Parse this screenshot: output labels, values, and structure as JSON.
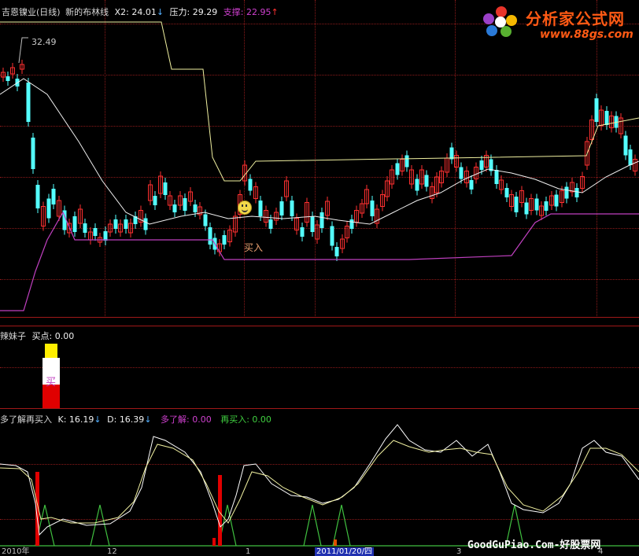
{
  "main_panel": {
    "title": "吉恩镍业(日线)",
    "indicator_name": "新的布林线",
    "x2_label": "X2: 24.01",
    "pressure_label": "压力: 29.29",
    "support_label": "支撑: 22.95",
    "high_price_label": "32.49",
    "buy_signal_label": "买入",
    "smiley_icon": "smiley-face-icon"
  },
  "mid_panel": {
    "title": "辣妹子",
    "buy_point_label": "买点: 0.00",
    "bar_char": "买"
  },
  "low_panel": {
    "title": "多了解再买入",
    "k_label": "K: 16.19",
    "d_label": "D: 16.39",
    "more_label": "多了解: 0.00",
    "rebuy_label": "再买入: 0.00"
  },
  "x_axis": {
    "labels": [
      "2010年",
      "12",
      "1",
      "2011/01/20/四",
      "3",
      "4"
    ]
  },
  "watermark": {
    "brand": "分析家公式网",
    "url": "www.88gs.com",
    "footer": "GoodGuPiao.Com-好股票网"
  },
  "colors": {
    "bg": "#000000",
    "up_candle": "#ff3030",
    "down_candle": "#54ffff",
    "boll_mid": "#f0f0f0",
    "boll_upper": "#f0f0a0",
    "boll_lower": "#c040c0",
    "k_line": "#ffffff",
    "d_line": "#f0f0a0",
    "signal_green": "#40c040",
    "bar_red": "#e00000",
    "bar_yellow": "#ffee00"
  },
  "chart_data": {
    "type": "candlestick",
    "price_labels_shown": {
      "high": 32.49
    },
    "legend_values": {
      "X2": 24.01,
      "pressure": 29.29,
      "support": 22.95,
      "K": 16.19,
      "D": 16.39
    }
  }
}
